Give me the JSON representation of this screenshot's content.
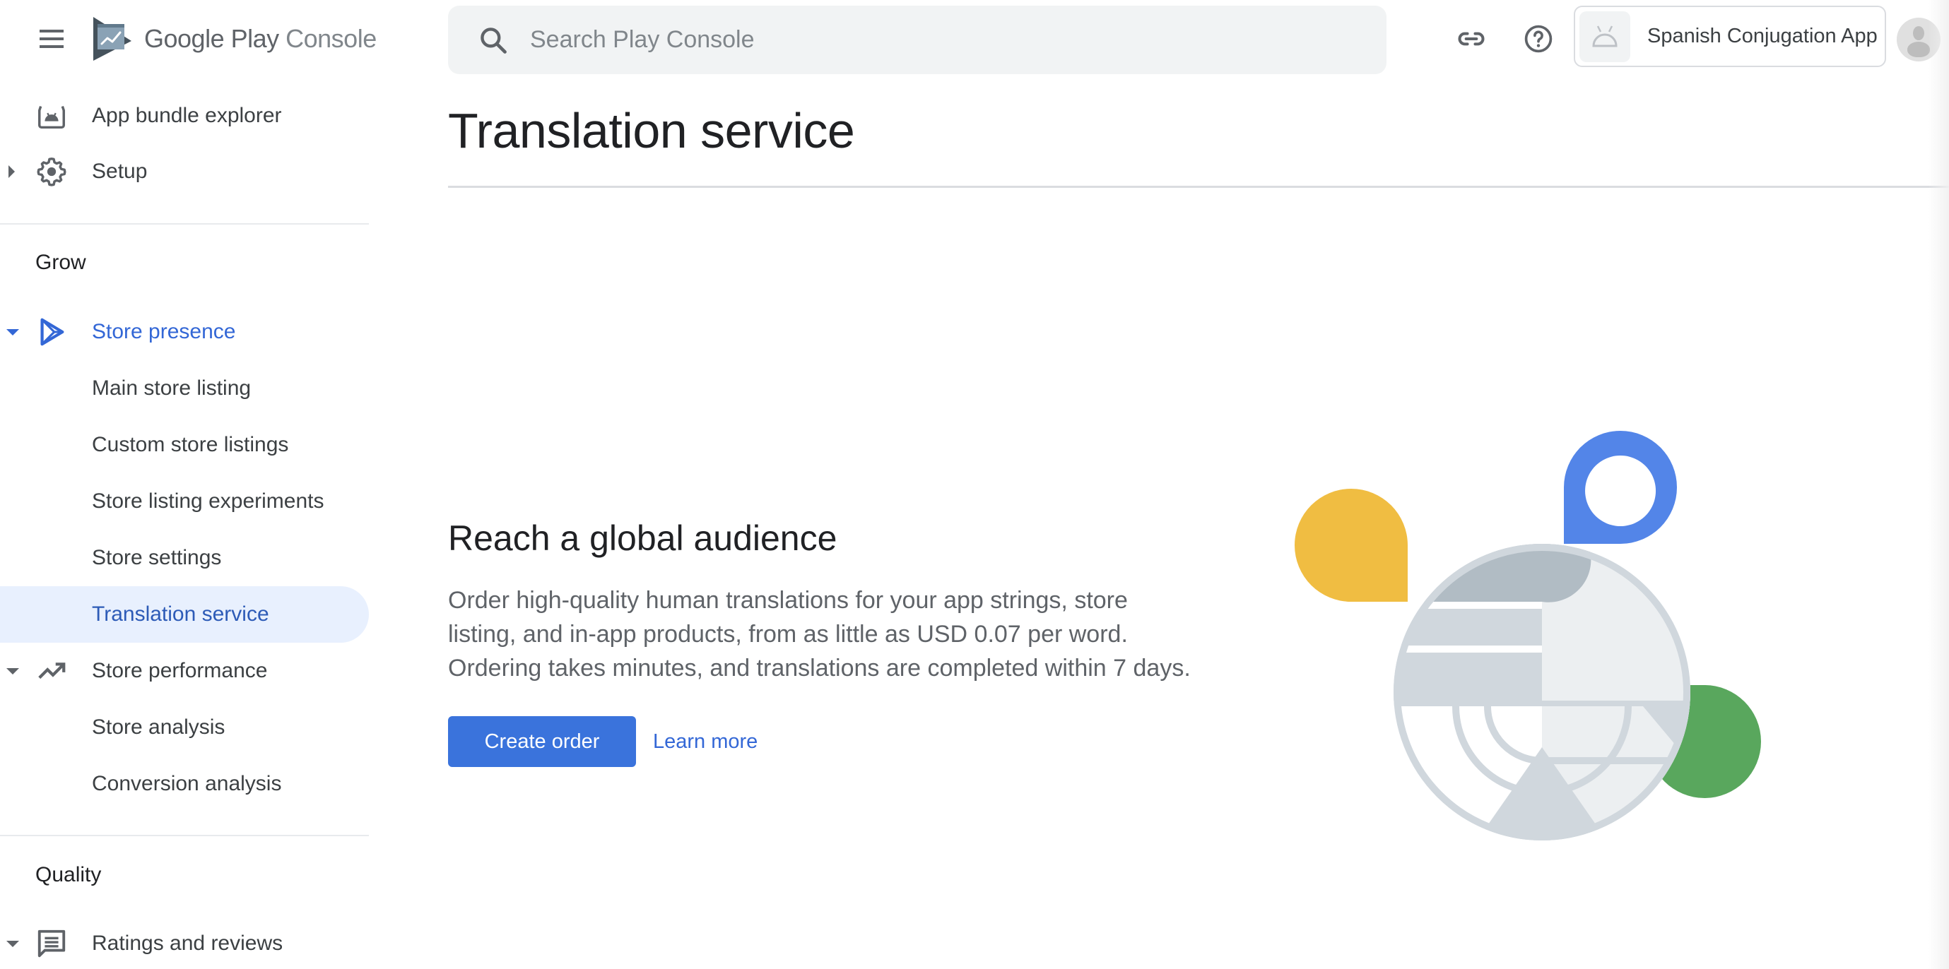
{
  "header": {
    "brand_primary": "Google Play",
    "brand_secondary": "Console",
    "search_placeholder": "Search Play Console",
    "search_value": "",
    "app_name": "Spanish Conjugation App",
    "icons": [
      "menu-icon",
      "play-console-logo",
      "search-icon",
      "link-icon",
      "help-icon",
      "android-icon",
      "avatar-icon"
    ]
  },
  "sidebar": {
    "items_top": [
      {
        "label": "App bundle explorer",
        "icon": "app-bundle-icon"
      },
      {
        "label": "Setup",
        "icon": "gear-icon",
        "caret": "collapsed"
      }
    ],
    "sections": [
      {
        "title": "Grow",
        "groups": [
          {
            "label": "Store presence",
            "icon": "play-outline-icon",
            "caret": "expanded",
            "active": true,
            "children": [
              {
                "label": "Main store listing"
              },
              {
                "label": "Custom store listings"
              },
              {
                "label": "Store listing experiments"
              },
              {
                "label": "Store settings"
              },
              {
                "label": "Translation service",
                "selected": true
              }
            ]
          },
          {
            "label": "Store performance",
            "icon": "trending-up-icon",
            "caret": "expanded",
            "children": [
              {
                "label": "Store analysis"
              },
              {
                "label": "Conversion analysis"
              }
            ]
          }
        ]
      },
      {
        "title": "Quality",
        "groups": [
          {
            "label": "Ratings and reviews",
            "icon": "reviews-icon",
            "caret": "expanded"
          }
        ]
      }
    ]
  },
  "main": {
    "title": "Translation service",
    "hero": {
      "heading": "Reach a global audience",
      "body": "Order high-quality human translations for your app strings, store listing, and in-app products, from as little as USD 0.07 per word. Ordering takes minutes, and translations are completed within 7 days.",
      "primary_button": "Create order",
      "secondary_link": "Learn more",
      "illustration": "globe-with-map-pins"
    }
  },
  "colors": {
    "accent": "#3367d6",
    "button": "#3a73dc",
    "selected_bg": "#e8f0fe",
    "pin_yellow": "#f0bd42",
    "pin_blue": "#5385e8",
    "pin_green": "#59a75d",
    "globe_light": "#eceff1",
    "globe_mid": "#d0d7dd",
    "globe_dark": "#b1bcc4"
  }
}
